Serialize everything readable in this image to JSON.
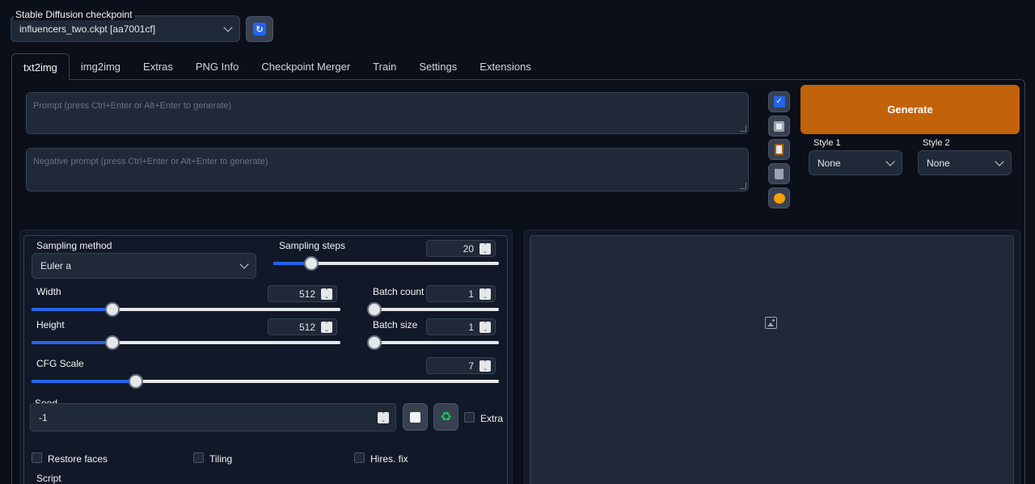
{
  "checkpoint": {
    "label": "Stable Diffusion checkpoint",
    "value": "influencers_two.ckpt [aa7001cf]"
  },
  "tabs": [
    {
      "label": "txt2img"
    },
    {
      "label": "img2img"
    },
    {
      "label": "Extras"
    },
    {
      "label": "PNG Info"
    },
    {
      "label": "Checkpoint Merger"
    },
    {
      "label": "Train"
    },
    {
      "label": "Settings"
    },
    {
      "label": "Extensions"
    }
  ],
  "prompt": {
    "placeholder": "Prompt (press Ctrl+Enter or Alt+Enter to generate)"
  },
  "negative_prompt": {
    "placeholder": "Negative prompt (press Ctrl+Enter or Alt+Enter to generate)"
  },
  "generate": {
    "label": "Generate"
  },
  "styles": {
    "style1_label": "Style 1",
    "style1_value": "None",
    "style2_label": "Style 2",
    "style2_value": "None"
  },
  "sampling": {
    "method_label": "Sampling method",
    "method_value": "Euler a",
    "steps_label": "Sampling steps",
    "steps_value": "20",
    "steps_fraction": 0.14
  },
  "width": {
    "label": "Width",
    "value": "512",
    "fraction": 0.24
  },
  "height": {
    "label": "Height",
    "value": "512",
    "fraction": 0.24
  },
  "batch_count": {
    "label": "Batch count",
    "value": "1",
    "fraction": 0.0
  },
  "batch_size": {
    "label": "Batch size",
    "value": "1",
    "fraction": 0.0
  },
  "cfg": {
    "label": "CFG Scale",
    "value": "7",
    "fraction": 0.21
  },
  "seed": {
    "label": "Seed",
    "value": "-1",
    "extra_label": "Extra"
  },
  "options": {
    "restore_faces": "Restore faces",
    "tiling": "Tiling",
    "hires_fix": "Hires. fix"
  },
  "script": {
    "label": "Script"
  },
  "colors": {
    "accent": "#2563eb",
    "generate": "#c2620a",
    "bg": "#0b0f19"
  }
}
